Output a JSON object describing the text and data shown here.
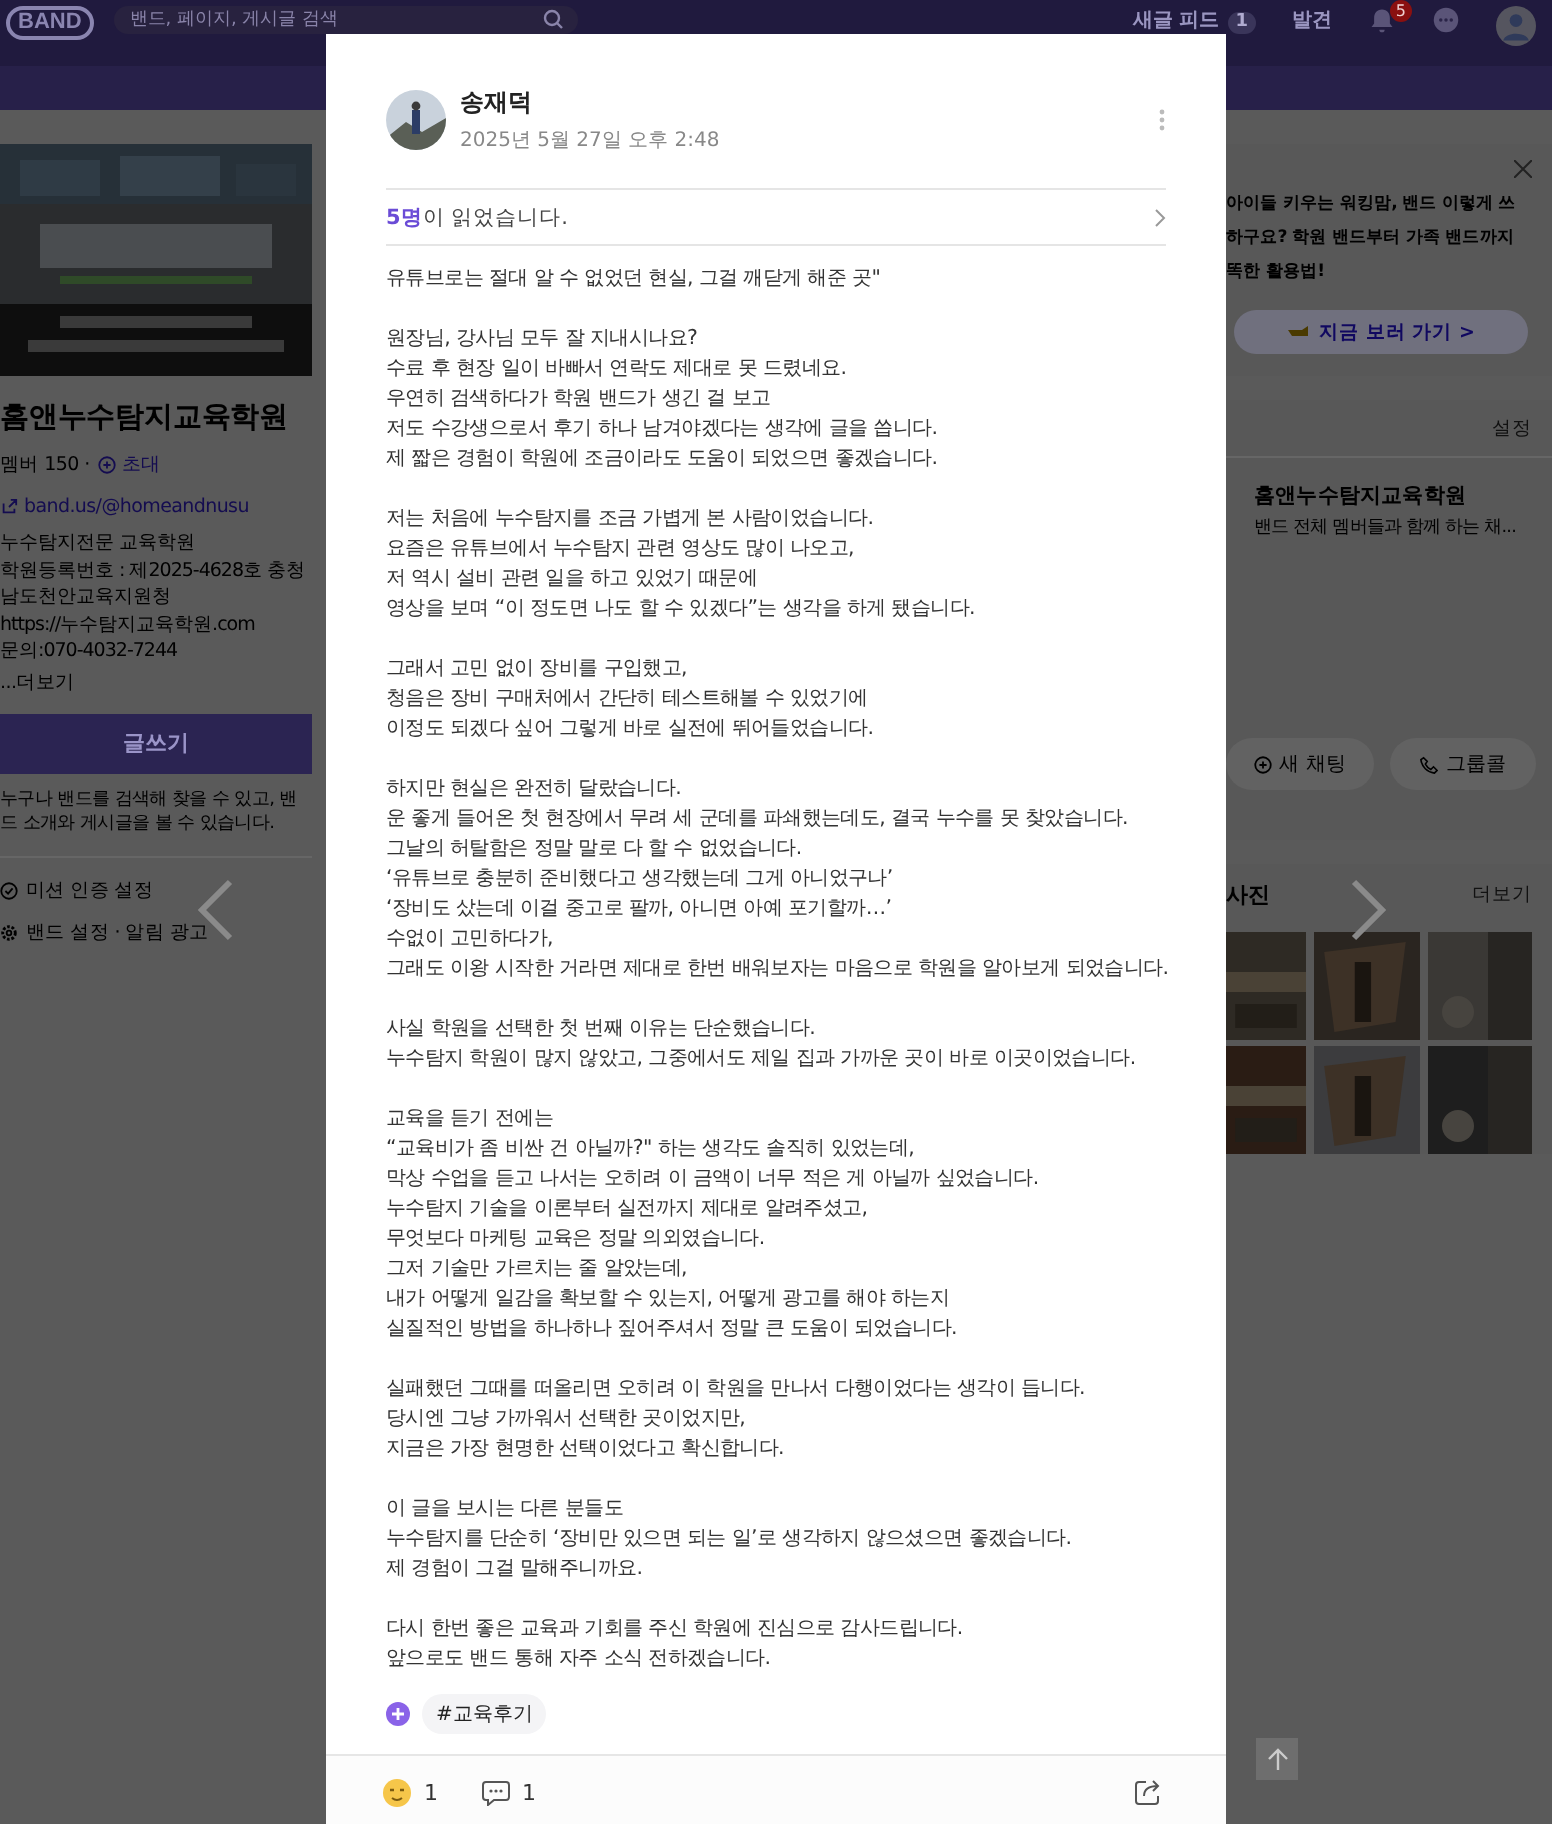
{
  "topbar": {
    "logo": "BAND",
    "search": {
      "placeholder": "밴드, 페이지, 게시글 검색"
    },
    "nav": [
      {
        "label": "새글 피드",
        "badge": "1"
      },
      {
        "label": "발견"
      }
    ],
    "notification_badge": "5"
  },
  "band": {
    "name": "홈앤누수탐지교육학원",
    "members": "멤버 150 ·",
    "invite": "초대",
    "link": "band.us/@homeandnusu",
    "description": [
      "누수탐지전문 교육학원",
      "학원등록번호 : 제2025-4628호 충청",
      "남도천안교육지원청",
      "https://누수탐지교육학원.com",
      "문의:070-4032-7244"
    ],
    "more": "...더보기",
    "write_button": "글쓰기",
    "notice": "누구나 밴드를 검색해 찾을 수 있고, 밴드 소개와 게시글을 볼 수 있습니다.",
    "menu": [
      "미션 인증 설정",
      "밴드 설정 · 알림 광고"
    ]
  },
  "promo": {
    "lines": [
      "아이들 키우는 워킹맘, 밴드 이렇게 쓰",
      "하구요? 학원 밴드부터 가족 밴드까지",
      "똑한 활용법!"
    ],
    "button": "지금 보러 가기 >"
  },
  "chat": {
    "settings": "설정",
    "rooms": [
      {
        "name": "홈앤누수탐지교육학원",
        "preview": "밴드 전체 멤버들과 함께 하는 채..."
      }
    ],
    "buttons": [
      "새 채팅",
      "그룹콜"
    ]
  },
  "photos": {
    "title": "사진",
    "more": "더보기"
  },
  "post": {
    "author": "송재덕",
    "date": "2025년 5월 27일 오후 2:48",
    "readers": "**5명**이 읽었습니다.",
    "paragraphs": [
      "유튜브로는 절대 알 수 없었던 현실, 그걸 깨닫게 해준 곳\"",
      "원장님, 강사님 모두 잘 지내시나요?\n수료 후 현장 일이 바빠서 연락도 제대로 못 드렸네요.\n우연히 검색하다가 학원 밴드가 생긴 걸 보고\n저도 수강생으로서 후기 하나 남겨야겠다는 생각에 글을 씁니다.\n제 짧은 경험이 학원에 조금이라도 도움이 되었으면 좋겠습니다.",
      "저는 처음에 누수탐지를 조금 가볍게 본 사람이었습니다.\n요즘은 유튜브에서 누수탐지 관련 영상도 많이 나오고,\n저 역시 설비 관련 일을 하고 있었기 때문에\n영상을 보며 “이 정도면 나도 할 수 있겠다”는 생각을 하게 됐습니다.",
      "그래서 고민 없이 장비를 구입했고,\n청음은 장비 구매처에서 간단히 테스트해볼 수 있었기에\n이정도 되겠다 싶어 그렇게 바로 실전에 뛰어들었습니다.",
      "하지만 현실은 완전히 달랐습니다.\n운 좋게 들어온 첫 현장에서 무려 세 군데를 파쇄했는데도, 결국 누수를 못 찾았습니다.\n그날의 허탈함은 정말 말로 다 할 수 없었습니다.\n‘유튜브로 충분히 준비했다고 생각했는데 그게 아니었구나’\n‘장비도 샀는데 이걸 중고로 팔까, 아니면 아예 포기할까…’\n수없이 고민하다가,\n그래도 이왕 시작한 거라면 제대로 한번 배워보자는 마음으로 학원을 알아보게 되었습니다.",
      "사실 학원을 선택한 첫 번째 이유는 단순했습니다.\n누수탐지 학원이 많지 않았고, 그중에서도 제일 집과 가까운 곳이 바로 이곳이었습니다.",
      "교육을 듣기 전에는\n“교육비가 좀 비싼 건 아닐까?\" 하는 생각도 솔직히 있었는데,\n막상 수업을 듣고 나서는 오히려 이 금액이 너무 적은 게 아닐까 싶었습니다.\n누수탐지 기술을 이론부터 실전까지 제대로 알려주셨고,\n무엇보다 마케팅 교육은 정말 의외였습니다.\n그저 기술만 가르치는 줄 알았는데,\n내가 어떻게 일감을 확보할 수 있는지, 어떻게 광고를 해야 하는지\n실질적인 방법을 하나하나 짚어주셔서 정말 큰 도움이 되었습니다.",
      "실패했던 그때를 떠올리면 오히려 이 학원을 만나서 다행이었다는 생각이 듭니다.\n당시엔 그냥 가까워서 선택한 곳이었지만,\n지금은 가장 현명한 선택이었다고 확신합니다.",
      "이 글을 보시는 다른 분들도\n누수탐지를 단순히 ‘장비만 있으면 되는 일’로 생각하지 않으셨으면 좋겠습니다.\n제 경험이 그걸 말해주니까요.",
      "다시 한번 좋은 교육과 기회를 주신 학원에 진심으로 감사드립니다.\n앞으로도 밴드 통해 자주 소식 전하겠습니다."
    ],
    "hashtags": [
      "#교육후기"
    ],
    "reactions": "1",
    "comments": "1"
  }
}
